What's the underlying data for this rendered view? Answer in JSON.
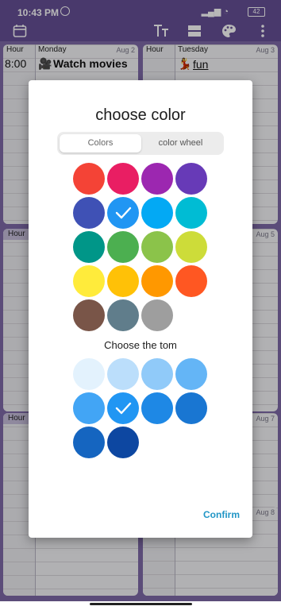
{
  "status_bar": {
    "time": "10:43 PM",
    "signal_text": "▂▄▆ ◔",
    "battery": "42"
  },
  "toolbar": {
    "icons": [
      "calendar-icon",
      "moon-icon",
      "text-size-icon",
      "layout-icon",
      "palette-icon",
      "more-vert-icon"
    ]
  },
  "calendar": {
    "hour_label": "Hour",
    "columns": [
      {
        "day": "Monday",
        "date": "Aug 2",
        "event_time": "8:00",
        "event_emoji": "🎥",
        "event_title": "Watch movies"
      },
      {
        "day": "Tuesday",
        "date": "Aug 3",
        "event_emoji": "💃",
        "event_title": "fun"
      }
    ],
    "lower_dates": [
      "Aug 5",
      "Aug 7",
      "Aug 8"
    ]
  },
  "dialog": {
    "title": "choose color",
    "tabs": [
      {
        "label": "Colors",
        "active": true
      },
      {
        "label": "color wheel",
        "active": false
      }
    ],
    "colors": [
      "#f44336",
      "#e91e63",
      "#9c27b0",
      "#673ab7",
      "#3f51b5",
      "#2196f3",
      "#03a9f4",
      "#00bcd4",
      "#009688",
      "#4caf50",
      "#8bc34a",
      "#cddc39",
      "#ffeb3b",
      "#ffc107",
      "#ff9800",
      "#ff5722",
      "#795548",
      "#607d8b",
      "#9e9e9e"
    ],
    "selected_color": "#2196f3",
    "shades_label": "Choose the tom",
    "shades": [
      "#e3f2fd",
      "#bbdefb",
      "#90caf9",
      "#64b5f6",
      "#42a5f5",
      "#2196f3",
      "#1e88e5",
      "#1976d2",
      "#1565c0",
      "#0d47a1"
    ],
    "selected_shade": "#2196f3",
    "confirm_label": "Confirm"
  }
}
